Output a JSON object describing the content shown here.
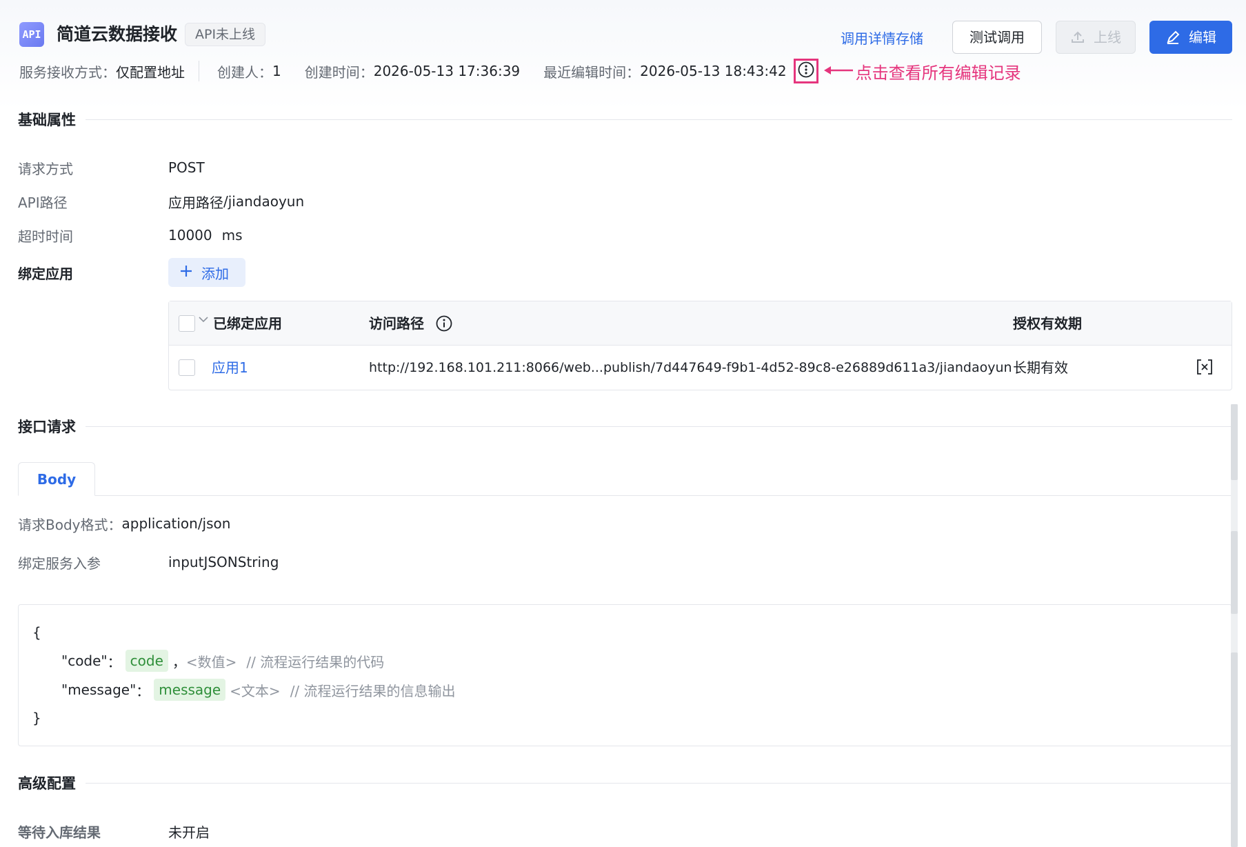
{
  "header": {
    "icon_text": "API",
    "title": "简道云数据接收",
    "status": "API未上线",
    "actions": {
      "detail_storage": "调用详情存储",
      "test_call": "测试调用",
      "go_online": "上线",
      "edit": "编辑"
    }
  },
  "meta": {
    "receive_mode_label": "服务接收方式：",
    "receive_mode_value": "仅配置地址",
    "creator_label": "创建人：",
    "creator_value": "1",
    "created_label": "创建时间：",
    "created_value": "2026-05-13 17:36:39",
    "edited_label": "最近编辑时间：",
    "edited_value": "2026-05-13 18:43:42",
    "annotation": "点击查看所有编辑记录"
  },
  "basic": {
    "title": "基础属性",
    "method_label": "请求方式",
    "method_value": "POST",
    "path_label": "API路径",
    "path_prefix": "应用路径",
    "path_value": "/jiandaoyun",
    "timeout_label": "超时时间",
    "timeout_value": "10000",
    "timeout_unit": "ms",
    "bind_label": "绑定应用",
    "add_label": "添加",
    "table": {
      "headers": [
        "已绑定应用",
        "访问路径",
        "授权有效期"
      ],
      "rows": [
        {
          "app": "应用1",
          "path": "http://192.168.101.211:8066/web...publish/7d447649-f9b1-4d52-89c8-e26889d611a3/jiandaoyun",
          "validity": "长期有效"
        }
      ]
    }
  },
  "request": {
    "title": "接口请求",
    "tab_body": "Body",
    "format_label": "请求Body格式：",
    "format_value": "application/json",
    "bind_param_label": "绑定服务入参",
    "bind_param_value": "inputJSONString",
    "code": {
      "open": "{",
      "close": "}",
      "lines": [
        {
          "key": "\"code\"",
          "colon": "：",
          "chip": "code",
          "sep": "，",
          "type": "<数值>",
          "comment": "// 流程运行结果的代码"
        },
        {
          "key": "\"message\"",
          "colon": "：",
          "chip": "message",
          "sep": "",
          "type": "<文本>",
          "comment": "// 流程运行结果的信息输出"
        }
      ]
    }
  },
  "advanced": {
    "title": "高级配置",
    "wait_label": "等待入库结果",
    "wait_value": "未开启"
  },
  "colors": {
    "primary": "#2e6be6",
    "annotation": "#e5357d",
    "path_prefix": "#f5a623",
    "chip_bg": "#e3f4e3"
  }
}
